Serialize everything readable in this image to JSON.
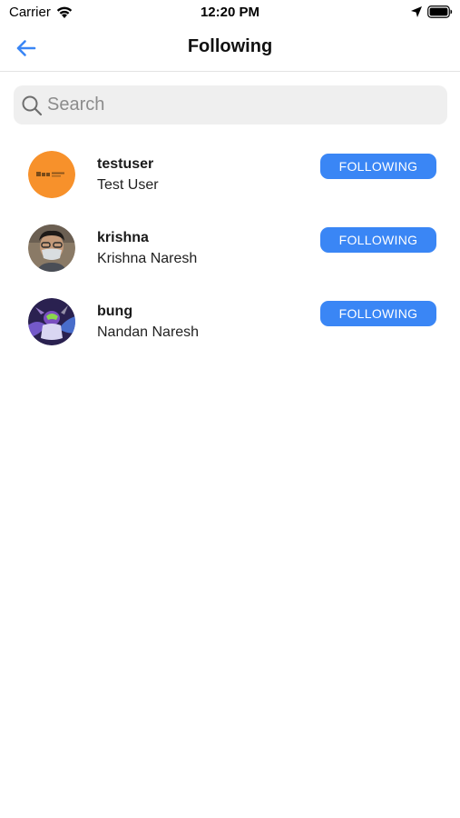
{
  "status_bar": {
    "carrier": "Carrier",
    "time": "12:20 PM",
    "icons": [
      "wifi-icon",
      "location-arrow-icon",
      "battery-icon"
    ]
  },
  "nav": {
    "title": "Following",
    "back_icon": "back-arrow-icon",
    "accent_color": "#3a86f5"
  },
  "search": {
    "placeholder": "Search",
    "value": ""
  },
  "users": [
    {
      "username": "testuser",
      "fullname": "Test User",
      "button_label": "FOLLOWING",
      "avatar": "orange-logo-avatar"
    },
    {
      "username": "krishna",
      "fullname": "Krishna Naresh",
      "button_label": "FOLLOWING",
      "avatar": "photo-avatar-masked-man"
    },
    {
      "username": "bung",
      "fullname": "Nandan Naresh",
      "button_label": "FOLLOWING",
      "avatar": "photo-avatar-game-character"
    }
  ],
  "colors": {
    "button_bg": "#3a86f5",
    "button_text": "#ffffff",
    "search_bg": "#efefef",
    "orange_avatar": "#f7912b"
  }
}
